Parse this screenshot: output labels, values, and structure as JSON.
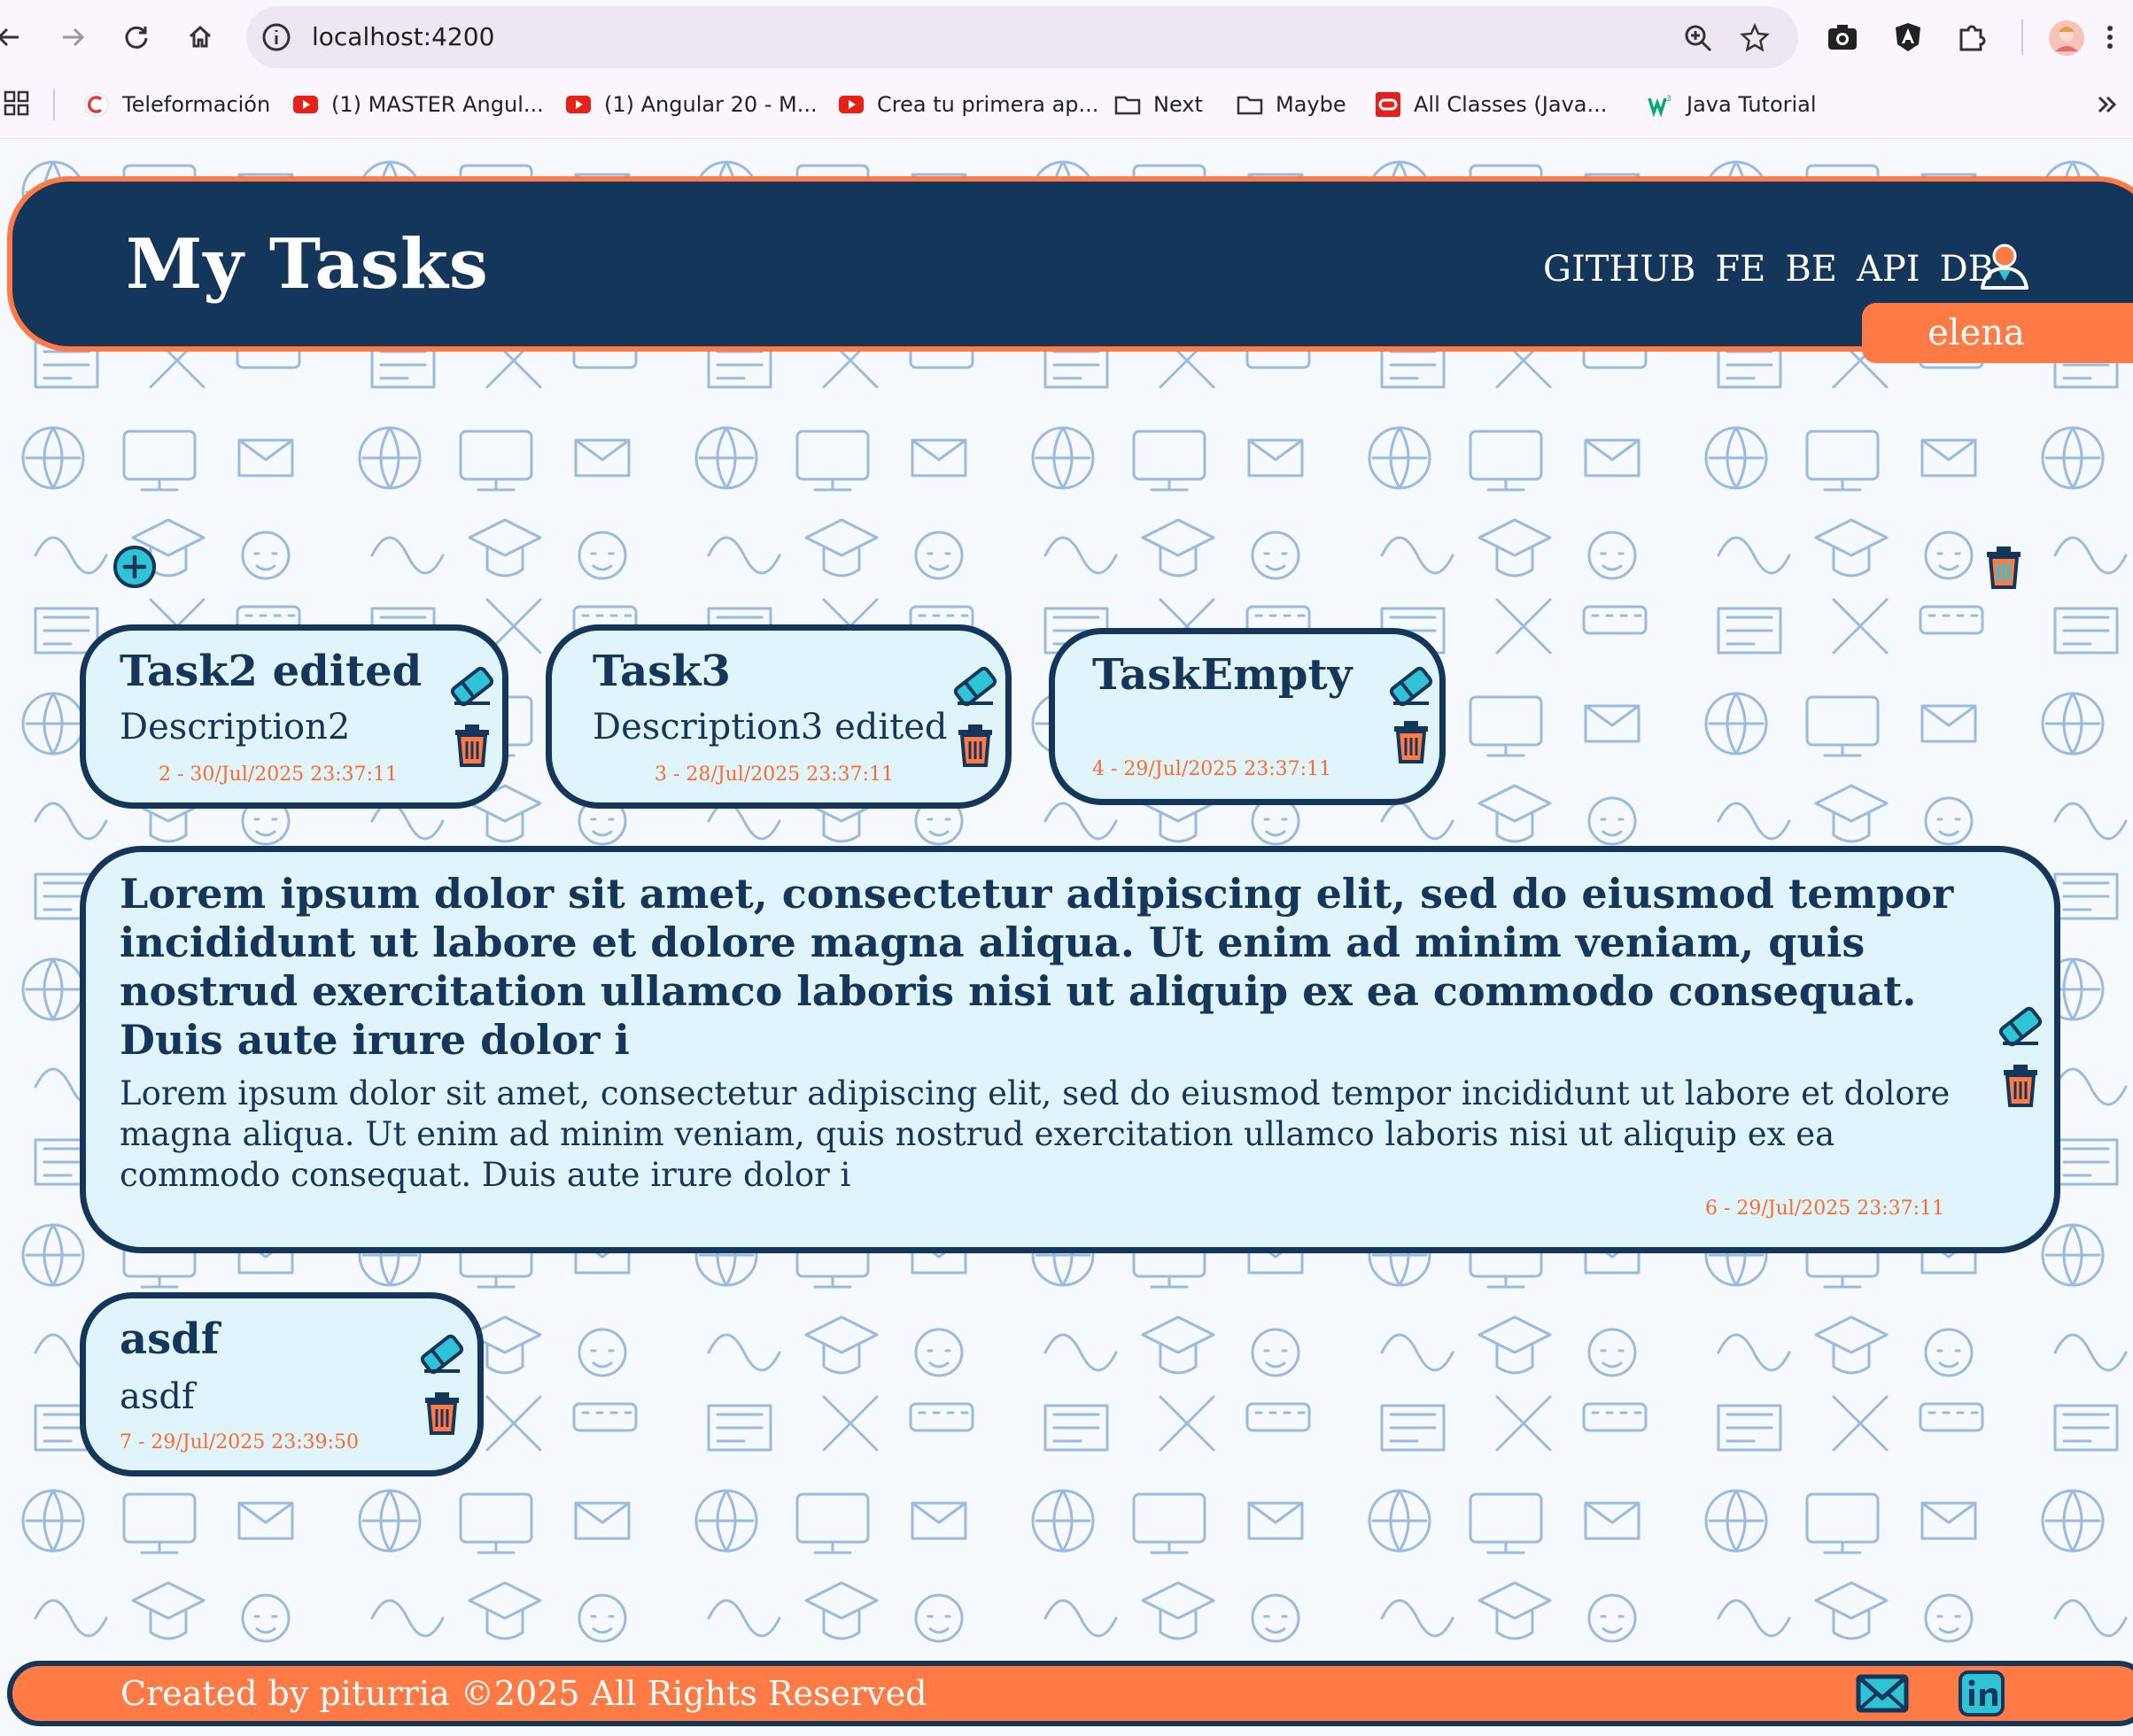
{
  "browser": {
    "url": "localhost:4200",
    "bookmarks": [
      {
        "label": "Teleformación",
        "icon": "teleformacion-icon"
      },
      {
        "label": "(1) MASTER Angul...",
        "icon": "youtube-icon"
      },
      {
        "label": "(1) Angular 20 - M...",
        "icon": "youtube-icon"
      },
      {
        "label": "Crea tu primera ap...",
        "icon": "youtube-icon"
      },
      {
        "label": "Next",
        "icon": "folder-icon"
      },
      {
        "label": "Maybe",
        "icon": "folder-icon"
      },
      {
        "label": "All Classes (Java...",
        "icon": "oracle-icon"
      },
      {
        "label": "Java Tutorial",
        "icon": "w3schools-icon"
      }
    ]
  },
  "header": {
    "title": "My Tasks",
    "nav": [
      "GITHUB",
      "FE",
      "BE",
      "API",
      "DB"
    ],
    "user": "elena"
  },
  "tasks": [
    {
      "title": "Task2 edited",
      "description": "Description2",
      "meta": "2 - 30/Jul/2025 23:37:11"
    },
    {
      "title": "Task3",
      "description": "Description3 edited",
      "meta": "3 - 28/Jul/2025 23:37:11"
    },
    {
      "title": "TaskEmpty",
      "description": "",
      "meta": "4 - 29/Jul/2025 23:37:11"
    },
    {
      "title": "Lorem ipsum dolor sit amet, consectetur adipiscing elit, sed do eiusmod tempor incididunt ut labore et dolore magna aliqua. Ut enim ad minim veniam, quis nostrud exercitation ullamco laboris nisi ut aliquip ex ea commodo consequat. Duis aute irure dolor i",
      "description": "Lorem ipsum dolor sit amet, consectetur adipiscing elit, sed do eiusmod tempor incididunt ut labore et dolore magna aliqua. Ut enim ad minim veniam, quis nostrud exercitation ullamco laboris nisi ut aliquip ex ea commodo consequat. Duis aute irure dolor i",
      "meta": "6 - 29/Jul/2025 23:37:11"
    },
    {
      "title": "asdf",
      "description": "asdf",
      "meta": "7 - 29/Jul/2025 23:39:50"
    }
  ],
  "footer": {
    "text": "Created by piturria ©2025 All Rights Reserved"
  },
  "colors": {
    "navy": "#14365b",
    "orange": "#ff7a45",
    "card_bg": "#e0f4fb",
    "cyan": "#2ec4d6"
  }
}
